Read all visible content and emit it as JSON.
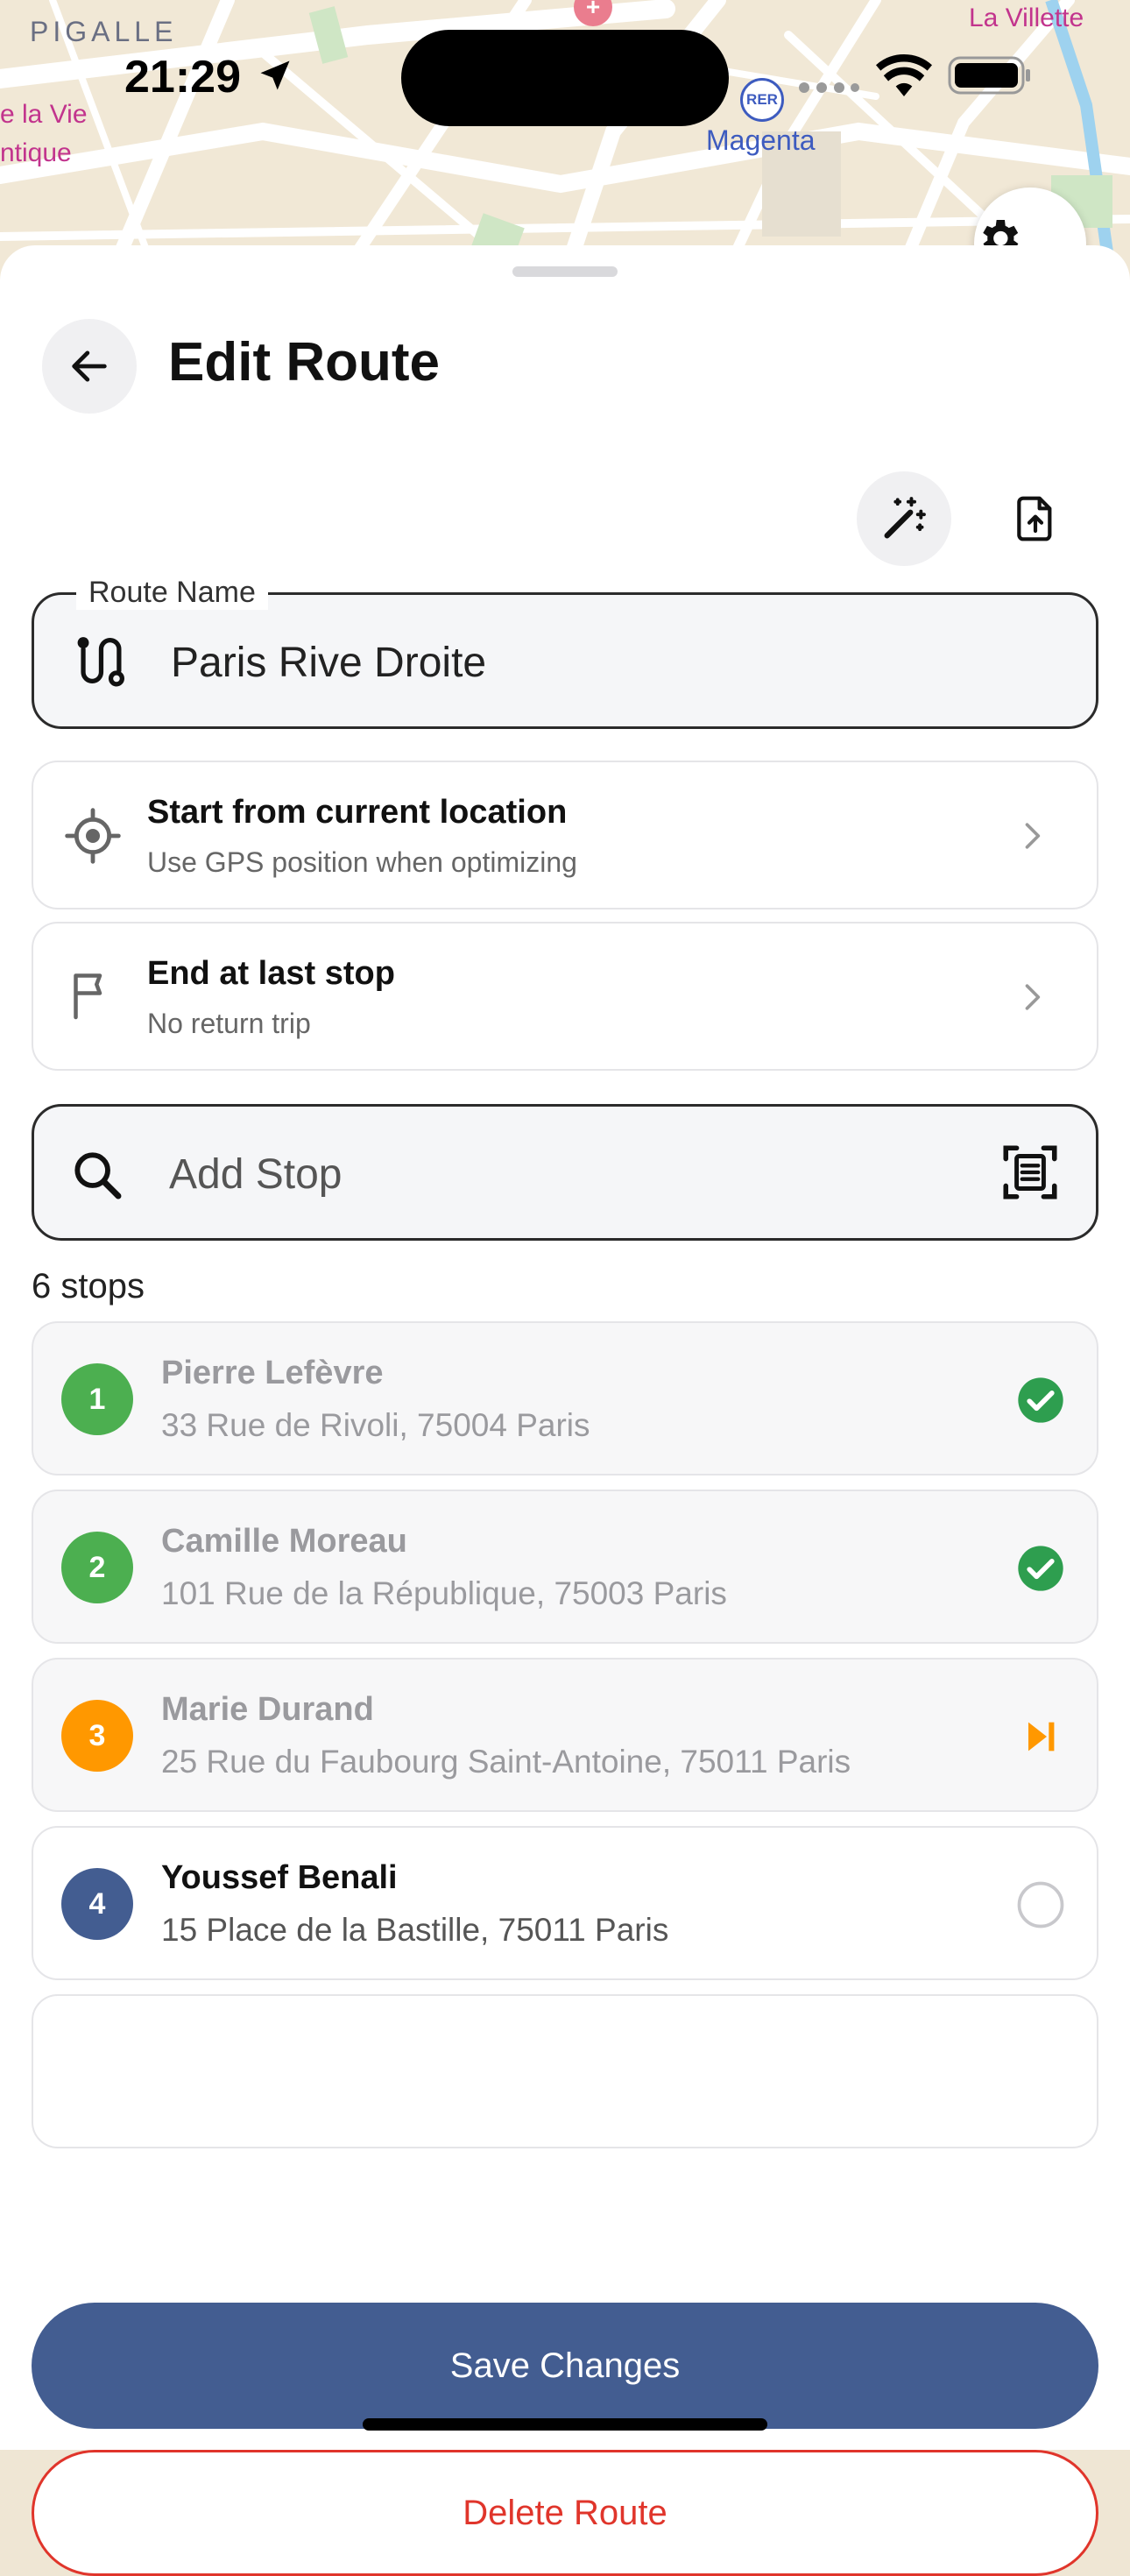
{
  "map": {
    "labels": {
      "pigalle": "PIGALLE",
      "la_vie": "e la Vie",
      "tique": "ntique",
      "villette": "La Villette",
      "magenta": "Magenta",
      "rer": "RER"
    },
    "settings_icon": "gear-icon"
  },
  "status_bar": {
    "time": "21:29",
    "icons": [
      "location-arrow-icon",
      "cellular-icon",
      "wifi-icon",
      "battery-icon"
    ]
  },
  "header": {
    "title": "Edit Route",
    "back_icon": "arrow-left-icon"
  },
  "toolbar": {
    "optimize_icon": "magic-wand-icon",
    "export_icon": "file-export-icon"
  },
  "route_name": {
    "label": "Route Name",
    "value": "Paris Rive Droite",
    "icon": "route-icon"
  },
  "options": [
    {
      "title": "Start from current location",
      "subtitle": "Use GPS position when optimizing",
      "icon": "gps-target-icon"
    },
    {
      "title": "End at last stop",
      "subtitle": "No return trip",
      "icon": "flag-icon"
    }
  ],
  "search": {
    "placeholder": "Add Stop",
    "icon": "search-icon",
    "scan_icon": "scan-document-icon"
  },
  "stops_count": "6 stops",
  "stops": [
    {
      "number": "1",
      "name": "Pierre Lefèvre",
      "address": "33 Rue de Rivoli, 75004 Paris",
      "status": "completed",
      "color": "#4caf50"
    },
    {
      "number": "2",
      "name": "Camille Moreau",
      "address": "101 Rue de la République, 75003 Paris",
      "status": "completed",
      "color": "#4caf50"
    },
    {
      "number": "3",
      "name": "Marie Durand",
      "address": "25 Rue du Faubourg Saint-Antoine, 75011 Paris",
      "status": "skipped",
      "color": "#ff9800"
    },
    {
      "number": "4",
      "name": "Youssef Benali",
      "address": "15 Place de la Bastille, 75011 Paris",
      "status": "pending",
      "color": "#435d91"
    }
  ],
  "actions": {
    "save_label": "Save Changes",
    "delete_label": "Delete Route",
    "save_color": "#435d91",
    "delete_color": "#e0352b"
  }
}
